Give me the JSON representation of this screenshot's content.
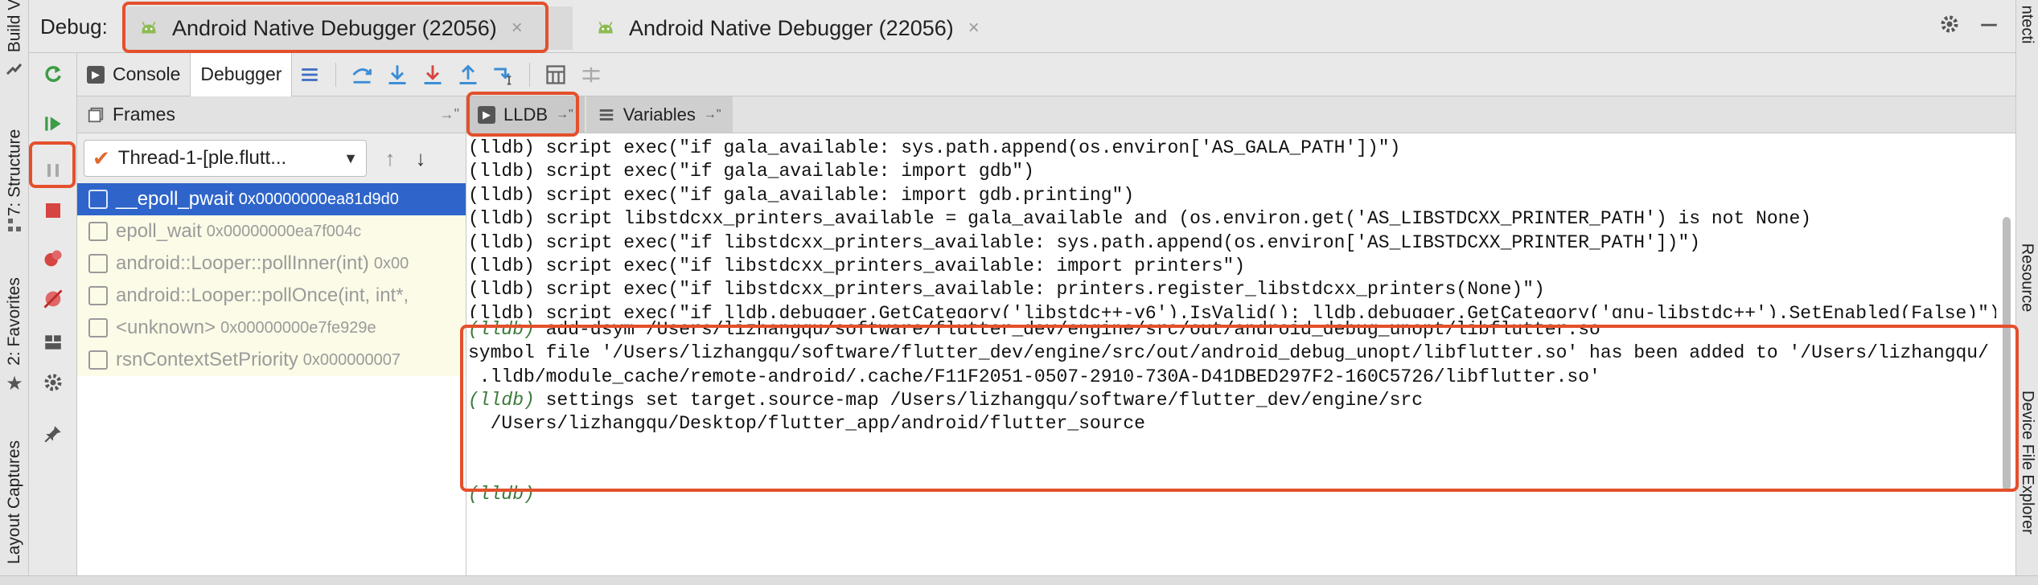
{
  "left_strip": {
    "tabs": [
      "Build V",
      "7: Structure",
      "2: Favorites",
      "Layout Captures"
    ]
  },
  "right_strip": {
    "tabs": [
      "ntecti",
      "Resource",
      "Device File Explorer"
    ]
  },
  "debug": {
    "label": "Debug:",
    "sessions": [
      {
        "title": "Android Native Debugger (22056)",
        "active": true
      },
      {
        "title": "Android Native Debugger (22056)",
        "active": false
      }
    ],
    "close_glyph": "×"
  },
  "subtabs": {
    "console": "Console",
    "debugger": "Debugger"
  },
  "frames": {
    "header": "Frames",
    "thread": "Thread-1-[ple.flutt...",
    "rows": [
      {
        "name": "__epoll_pwait",
        "addr": "0x00000000ea81d9d0",
        "selected": true
      },
      {
        "name": "epoll_wait",
        "addr": "0x00000000ea7f004c",
        "selected": false
      },
      {
        "name": "android::Looper::pollInner(int)",
        "addr": "0x00",
        "selected": false
      },
      {
        "name": "android::Looper::pollOnce(int, int*,",
        "addr": "",
        "selected": false
      },
      {
        "name": "<unknown>",
        "addr": "0x00000000e7fe929e",
        "selected": false
      },
      {
        "name": "rsnContextSetPriority",
        "addr": "0x000000007",
        "selected": false
      }
    ]
  },
  "console_tabs": {
    "lldb": "LLDB",
    "variables": "Variables"
  },
  "console": {
    "lines": [
      {
        "prompt": "",
        "text": "(lldb) script exec(\"if gala_available: sys.path.append(os.environ['AS_GALA_PATH'])\")"
      },
      {
        "prompt": "",
        "text": "(lldb) script exec(\"if gala_available: import gdb\")"
      },
      {
        "prompt": "",
        "text": "(lldb) script exec(\"if gala_available: import gdb.printing\")"
      },
      {
        "prompt": "",
        "text": "(lldb) script libstdcxx_printers_available = gala_available and (os.environ.get('AS_LIBSTDCXX_PRINTER_PATH') is not None)"
      },
      {
        "prompt": "",
        "text": "(lldb) script exec(\"if libstdcxx_printers_available: sys.path.append(os.environ['AS_LIBSTDCXX_PRINTER_PATH'])\")"
      },
      {
        "prompt": "",
        "text": "(lldb) script exec(\"if libstdcxx_printers_available: import printers\")"
      },
      {
        "prompt": "",
        "text": "(lldb) script exec(\"if libstdcxx_printers_available: printers.register_libstdcxx_printers(None)\")"
      },
      {
        "prompt": "",
        "text": "(lldb) script exec(\"if lldb.debugger.GetCategory('libstdc++-v6').IsValid(): lldb.debugger.GetCategory('gnu-libstdc++').SetEnabled(False)\")"
      },
      {
        "prompt": "(lldb)",
        "text": " add-dsym /Users/lizhangqu/software/flutter_dev/engine/src/out/android_debug_unopt/libflutter.so"
      },
      {
        "prompt": "",
        "text": "symbol file '/Users/lizhangqu/software/flutter_dev/engine/src/out/android_debug_unopt/libflutter.so' has been added to '/Users/lizhangqu/"
      },
      {
        "prompt": "",
        "text": " .lldb/module_cache/remote-android/.cache/F11F2051-0507-2910-730A-D41DBED297F2-160C5726/libflutter.so'"
      },
      {
        "prompt": "(lldb)",
        "text": " settings set target.source-map /Users/lizhangqu/software/flutter_dev/engine/src"
      },
      {
        "prompt": "",
        "text": "  /Users/lizhangqu/Desktop/flutter_app/android/flutter_source"
      },
      {
        "prompt": "",
        "text": ""
      },
      {
        "prompt": "",
        "text": ""
      },
      {
        "prompt": "(lldb)",
        "text": ""
      }
    ]
  },
  "colors": {
    "highlight": "#e4502c",
    "selection": "#2f65ca",
    "prompt": "#3a7a3a",
    "android_green": "#8dbb54"
  }
}
